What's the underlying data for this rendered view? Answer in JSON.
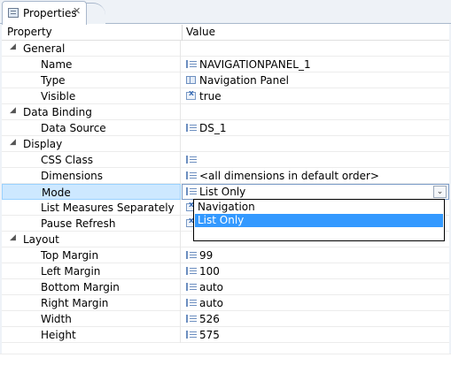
{
  "tab": {
    "title": "Properties",
    "close_glyph": "✕",
    "icon": "properties-icon"
  },
  "header": {
    "property": "Property",
    "value": "Value"
  },
  "rows": [
    {
      "kind": "category",
      "name": "General"
    },
    {
      "kind": "prop",
      "name": "Name",
      "value": "NAVIGATIONPANEL_1",
      "icon": "list-icon"
    },
    {
      "kind": "prop",
      "name": "Type",
      "value": "Navigation Panel",
      "icon": "panel-icon"
    },
    {
      "kind": "prop",
      "name": "Visible",
      "value": "true",
      "icon": "boolean-icon"
    },
    {
      "kind": "category",
      "name": "Data Binding"
    },
    {
      "kind": "prop",
      "name": "Data Source",
      "value": "DS_1",
      "icon": "list-icon"
    },
    {
      "kind": "category",
      "name": "Display"
    },
    {
      "kind": "prop",
      "name": "CSS Class",
      "value": "",
      "icon": "list-icon"
    },
    {
      "kind": "prop",
      "name": "Dimensions",
      "value": "<all dimensions in default order>",
      "icon": "list-icon"
    },
    {
      "kind": "prop",
      "name": "Mode",
      "value": "List Only",
      "icon": "list-icon",
      "selected": true
    },
    {
      "kind": "prop",
      "name": "List Measures Separately",
      "value": "",
      "icon": "boolean-icon"
    },
    {
      "kind": "prop",
      "name": "Pause Refresh",
      "value": "",
      "icon": "boolean-icon"
    },
    {
      "kind": "category",
      "name": "Layout"
    },
    {
      "kind": "prop",
      "name": "Top Margin",
      "value": "99",
      "icon": "list-icon"
    },
    {
      "kind": "prop",
      "name": "Left Margin",
      "value": "100",
      "icon": "list-icon"
    },
    {
      "kind": "prop",
      "name": "Bottom Margin",
      "value": "auto",
      "icon": "list-icon"
    },
    {
      "kind": "prop",
      "name": "Right Margin",
      "value": "auto",
      "icon": "list-icon"
    },
    {
      "kind": "prop",
      "name": "Width",
      "value": "526",
      "icon": "list-icon"
    },
    {
      "kind": "prop",
      "name": "Height",
      "value": "575",
      "icon": "list-icon"
    }
  ],
  "mode_dropdown": {
    "options": [
      "Navigation",
      "List Only"
    ],
    "selected": "List Only",
    "button_glyph": "⌄"
  },
  "colors": {
    "selection": "#3399ff",
    "row_selected": "#cde8ff"
  }
}
